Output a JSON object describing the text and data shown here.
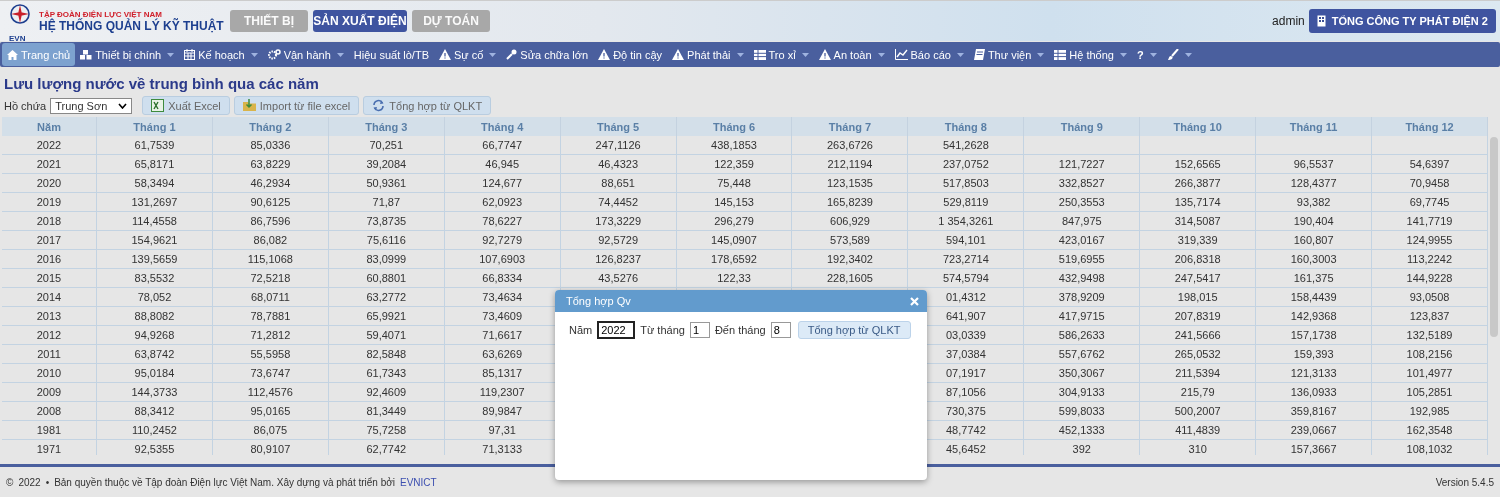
{
  "brand": {
    "org": "TẬP ĐOÀN ĐIỆN LỰC VIỆT NAM",
    "system": "HỆ THỐNG QUẢN LÝ KỸ THUẬT",
    "logo_text": "EVN"
  },
  "modules": [
    {
      "label": "THIẾT BỊ",
      "selected": false
    },
    {
      "label": "SẢN XUẤT ĐIỆN",
      "selected": true
    },
    {
      "label": "DỰ TOÁN",
      "selected": false
    }
  ],
  "user": {
    "name": "admin",
    "company": "TỔNG CÔNG TY PHÁT ĐIỆN 2"
  },
  "nav": [
    {
      "label": "Trang chủ",
      "dropdown": false,
      "selected": true
    },
    {
      "label": "Thiết bị chính",
      "dropdown": true,
      "selected": false
    },
    {
      "label": "Kế hoạch",
      "dropdown": true,
      "selected": false
    },
    {
      "label": "Vận hành",
      "dropdown": true,
      "selected": false
    },
    {
      "label": "Hiệu suất lò/TB",
      "dropdown": false,
      "selected": false
    },
    {
      "label": "Sự cố",
      "dropdown": true,
      "selected": false
    },
    {
      "label": "Sửa chữa lớn",
      "dropdown": false,
      "selected": false
    },
    {
      "label": "Độ tin cậy",
      "dropdown": false,
      "selected": false
    },
    {
      "label": "Phát thải",
      "dropdown": true,
      "selected": false
    },
    {
      "label": "Tro xỉ",
      "dropdown": true,
      "selected": false
    },
    {
      "label": "An toàn",
      "dropdown": true,
      "selected": false
    },
    {
      "label": "Báo cáo",
      "dropdown": true,
      "selected": false
    },
    {
      "label": "Thư viện",
      "dropdown": true,
      "selected": false
    },
    {
      "label": "Hệ thống",
      "dropdown": true,
      "selected": false
    },
    {
      "label": "?",
      "dropdown": true,
      "selected": false
    },
    {
      "dropdown": true,
      "selected": false
    }
  ],
  "page_title": "Lưu lượng nước về trung bình qua các năm",
  "toolbar": {
    "reservoir_label": "Hồ chứa",
    "reservoir": "Trung Sơn",
    "buttons": [
      {
        "label": "Xuất Excel"
      },
      {
        "label": "Import từ file excel"
      },
      {
        "label": "Tổng hợp từ QLKT"
      }
    ]
  },
  "table": {
    "columns": [
      "Năm",
      "Tháng 1",
      "Tháng 2",
      "Tháng 3",
      "Tháng 4",
      "Tháng 5",
      "Tháng 6",
      "Tháng 7",
      "Tháng 8",
      "Tháng 9",
      "Tháng 10",
      "Tháng 11",
      "Tháng 12"
    ],
    "rows": [
      [
        "2022",
        "61,7539",
        "85,0336",
        "70,251",
        "66,7747",
        "247,1126",
        "438,1853",
        "263,6726",
        "541,2628",
        null,
        null,
        null,
        null
      ],
      [
        "2021",
        "65,8171",
        "63,8229",
        "39,2084",
        "46,945",
        "46,4323",
        "122,359",
        "212,1194",
        "237,0752",
        "121,7227",
        "152,6565",
        "96,5537",
        "54,6397"
      ],
      [
        "2020",
        "58,3494",
        "46,2934",
        "50,9361",
        "124,677",
        "88,651",
        "75,448",
        "123,1535",
        "517,8503",
        "332,8527",
        "266,3877",
        "128,4377",
        "70,9458"
      ],
      [
        "2019",
        "131,2697",
        "90,6125",
        "71,87",
        "62,0923",
        "74,4452",
        "145,153",
        "165,8239",
        "529,8119",
        "250,3553",
        "135,7174",
        "93,382",
        "69,7745"
      ],
      [
        "2018",
        "114,4558",
        "86,7596",
        "73,8735",
        "78,6227",
        "173,3229",
        "296,279",
        "606,929",
        "1 354,3261",
        "847,975",
        "314,5087",
        "190,404",
        "141,7719"
      ],
      [
        "2017",
        "154,9621",
        "86,082",
        "75,6116",
        "92,7279",
        "92,5729",
        "145,0907",
        "573,589",
        "594,101",
        "423,0167",
        "319,339",
        "160,807",
        "124,9955"
      ],
      [
        "2016",
        "139,5659",
        "115,1068",
        "83,0999",
        "107,6903",
        "126,8237",
        "178,6592",
        "192,3402",
        "723,2714",
        "519,6955",
        "206,8318",
        "160,3003",
        "113,2242"
      ],
      [
        "2015",
        "83,5532",
        "72,5218",
        "60,8801",
        "66,8334",
        "43,5276",
        "122,33",
        "228,1605",
        "574,5794",
        "432,9498",
        "247,5417",
        "161,375",
        "144,9228"
      ],
      [
        "2014",
        "78,052",
        "68,0711",
        "63,2772",
        "73,4634",
        null,
        null,
        null,
        "01,4312",
        "378,9209",
        "198,015",
        "158,4439",
        "93,0508"
      ],
      [
        "2013",
        "88,8082",
        "78,7881",
        "65,9921",
        "73,4609",
        null,
        null,
        null,
        "641,907",
        "417,9715",
        "207,8319",
        "142,9368",
        "123,837"
      ],
      [
        "2012",
        "94,9268",
        "71,2812",
        "59,4071",
        "71,6617",
        null,
        null,
        null,
        "03,0339",
        "586,2633",
        "241,5666",
        "157,1738",
        "132,5189"
      ],
      [
        "2011",
        "63,8742",
        "55,5958",
        "82,5848",
        "63,6269",
        null,
        null,
        null,
        "37,0384",
        "557,6762",
        "265,0532",
        "159,393",
        "108,2156"
      ],
      [
        "2010",
        "95,0184",
        "73,6747",
        "61,7343",
        "85,1317",
        null,
        null,
        null,
        "07,1917",
        "350,3067",
        "211,5394",
        "121,3133",
        "101,4977"
      ],
      [
        "2009",
        "144,3733",
        "112,4576",
        "92,4609",
        "119,2307",
        null,
        null,
        null,
        "87,1056",
        "304,9133",
        "215,79",
        "136,0933",
        "105,2851"
      ],
      [
        "2008",
        "88,3412",
        "95,0165",
        "81,3449",
        "89,9847",
        null,
        null,
        null,
        "730,375",
        "599,8033",
        "500,2007",
        "359,8167",
        "192,985"
      ],
      [
        "1981",
        "110,2452",
        "86,075",
        "75,7258",
        "97,31",
        null,
        null,
        null,
        "48,7742",
        "452,1333",
        "411,4839",
        "239,0667",
        "162,3548"
      ],
      [
        "1971",
        "92,5355",
        "80,9107",
        "62,7742",
        "71,3133",
        null,
        null,
        null,
        "45,6452",
        "392",
        "310",
        "157,3667",
        "108,1032"
      ]
    ]
  },
  "dialog": {
    "title": "Tổng hợp Qv",
    "fields": [
      {
        "label": "Năm",
        "value": "2022",
        "focused": true
      },
      {
        "label": "Từ tháng",
        "value": "1",
        "focused": false
      },
      {
        "label": "Đến tháng",
        "value": "8",
        "focused": false
      }
    ],
    "button": "Tổng hợp từ QLKT"
  },
  "footer": {
    "copyright": "©",
    "year": "2022",
    "separator": "•",
    "text": "Bản quyền thuộc về Tập đoàn Điện lực Việt Nam. Xây dựng và phát triển bởi",
    "link": "EVNICT",
    "version": "Version 5.4.5"
  }
}
